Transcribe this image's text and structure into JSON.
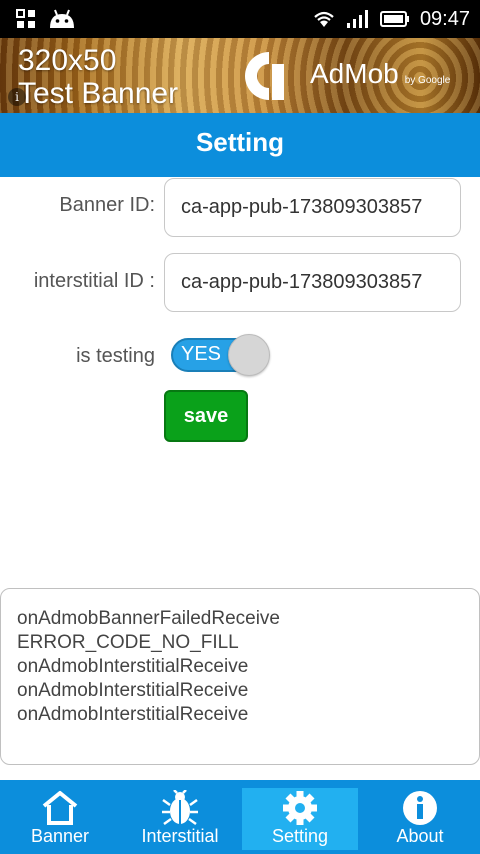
{
  "status_bar": {
    "time": "09:47"
  },
  "ad": {
    "line1": "320x50",
    "line2": "Test Banner",
    "brand": "AdMob",
    "brand_by": "by Google",
    "info": "i"
  },
  "header": {
    "title": "Setting"
  },
  "form": {
    "banner_id_label": "Banner ID:",
    "banner_id_value": "ca-app-pub-173809303857",
    "interstitial_id_label": "interstitial ID :",
    "interstitial_id_value": "ca-app-pub-173809303857",
    "is_testing_label": "is testing",
    "is_testing_toggle": "YES",
    "save_label": "save"
  },
  "log": {
    "lines": [
      "onAdmobBannerFailedReceive",
      "ERROR_CODE_NO_FILL",
      "onAdmobInterstitialReceive",
      "onAdmobInterstitialReceive",
      "onAdmobInterstitialReceive"
    ]
  },
  "bottom_nav": {
    "items": [
      {
        "label": "Banner",
        "icon": "home-icon"
      },
      {
        "label": "Interstitial",
        "icon": "bug-icon"
      },
      {
        "label": "Setting",
        "icon": "gear-icon",
        "active": true
      },
      {
        "label": "About",
        "icon": "info-icon"
      }
    ]
  },
  "colors": {
    "primary": "#0c8edc",
    "active_tab": "#22b0f0",
    "save_button": "#0aa11a",
    "toggle_on": "#27a1e6"
  }
}
